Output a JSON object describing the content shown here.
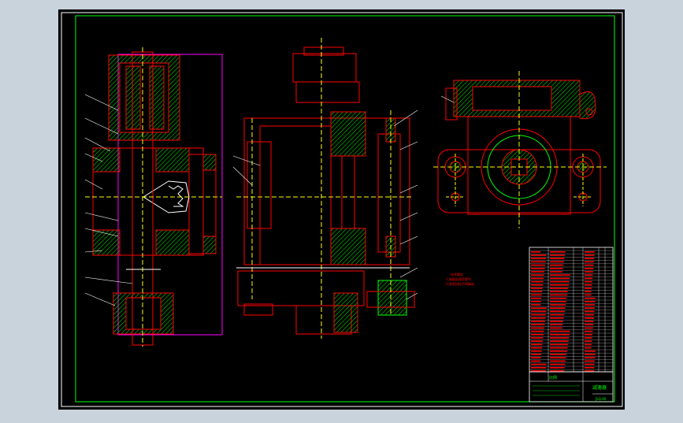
{
  "colors": {
    "canvas": "#c9d3dc",
    "sheet": "#000000",
    "border": "#ffffff",
    "frame": "#00ff00",
    "line": "#ff0000",
    "hatch": "#00c800",
    "center": "#ffff00",
    "pink": "#ff00ff",
    "text": "#ff0000",
    "title_text": "#00ff00"
  },
  "drawing": {
    "views": [
      "left-section-view",
      "middle-section-view",
      "right-top-view"
    ],
    "notes": [
      "技术要求",
      "1.装配前清洗零件",
      "2.各密封处不得漏油"
    ],
    "title_block": {
      "drawing_name": "减速器",
      "sheet_label": "比例",
      "drawing_no": "JSQ-00"
    }
  }
}
